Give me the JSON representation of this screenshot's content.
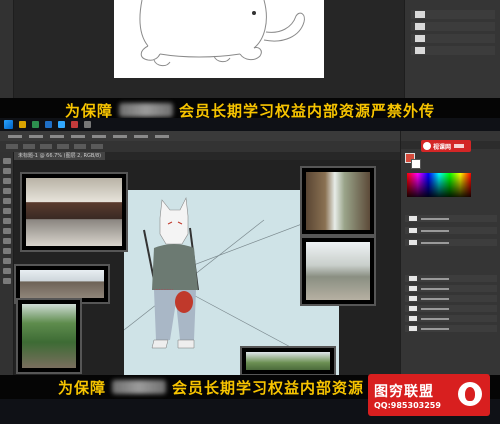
{
  "banner": {
    "prefix": "为保障",
    "suffix": "会员长期学习权益内部资源严禁外传",
    "suffix_cut": "会员长期学习权益内部资源"
  },
  "document": {
    "tab_title": "未标题-1 @ 66.7% (图层 2, RGB/8)"
  },
  "brand": {
    "logo_text": "视课网"
  },
  "watermark": {
    "title": "图穷联盟",
    "qq": "QQ:985303259"
  },
  "colors": {
    "banner_text": "#f7c400",
    "canvas_bg": "#cfe3e7",
    "watermark_red": "#d81f1f"
  }
}
